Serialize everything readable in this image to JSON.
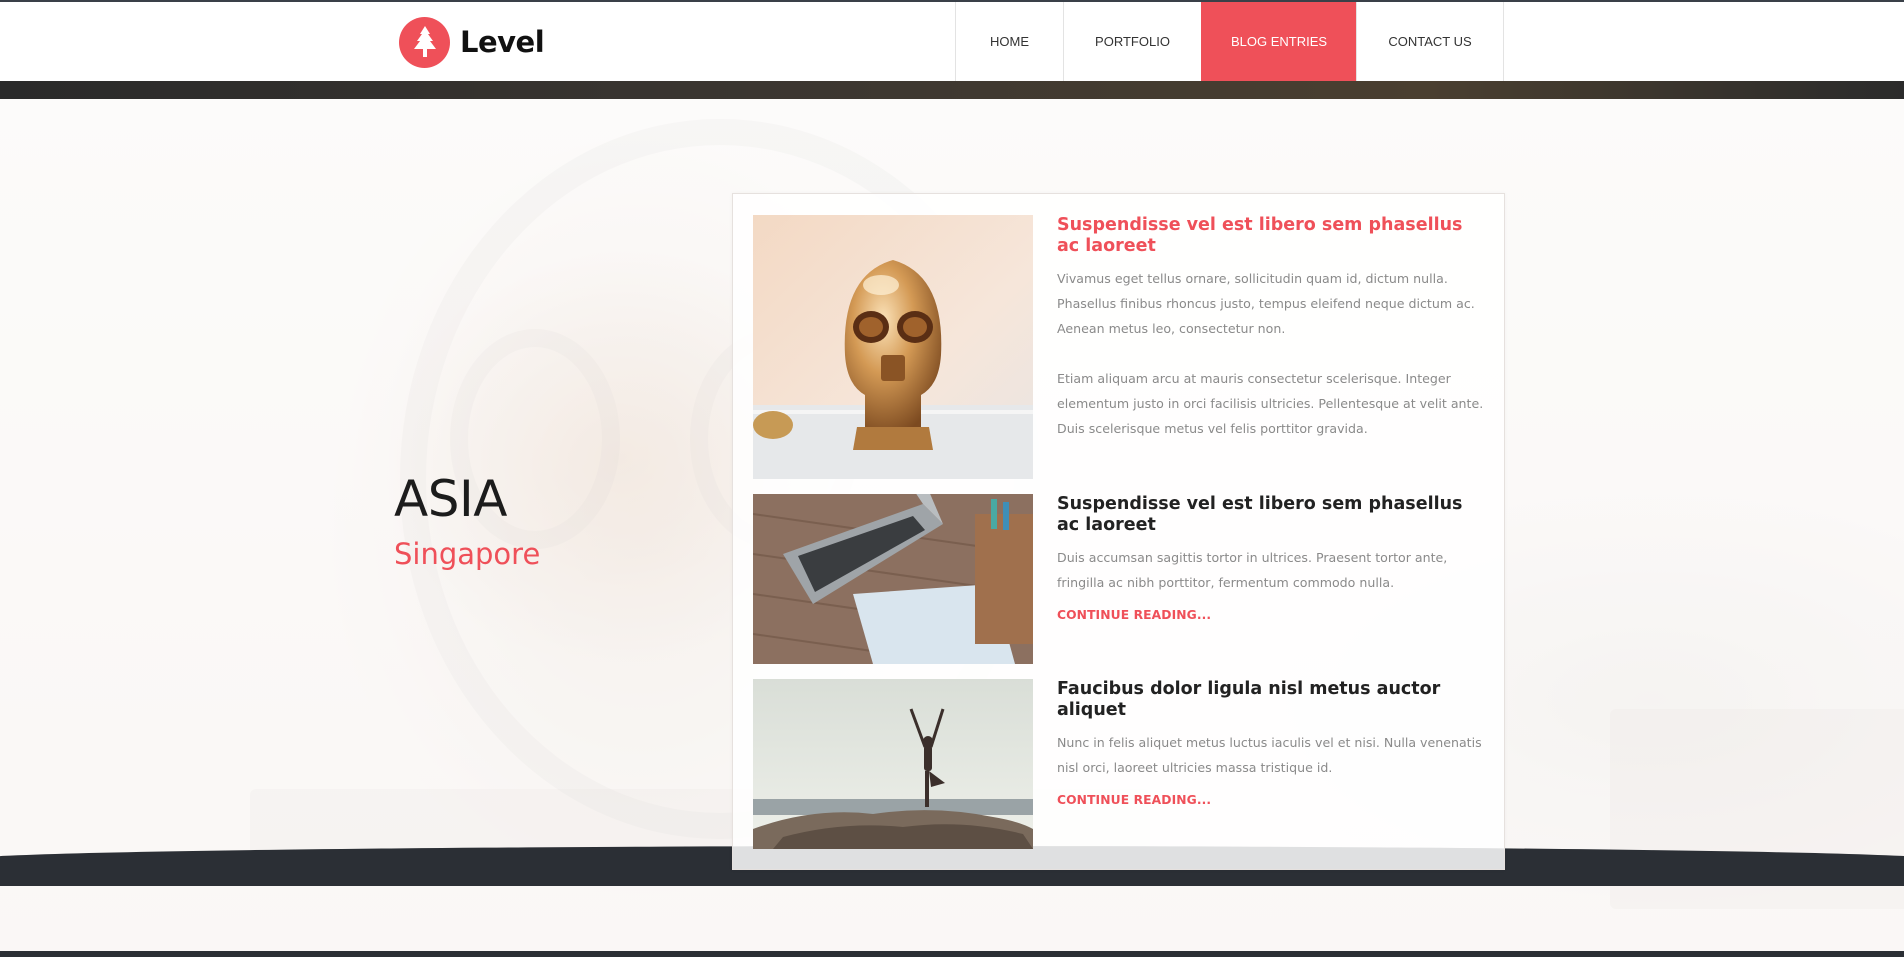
{
  "brand": {
    "name": "Level",
    "logo_icon": "pine-tree-icon",
    "accent_color": "#ef5059"
  },
  "nav": {
    "items": [
      {
        "label": "HOME",
        "active": false
      },
      {
        "label": "PORTFOLIO",
        "active": false
      },
      {
        "label": "BLOG ENTRIES",
        "active": true
      },
      {
        "label": "CONTACT US",
        "active": false
      }
    ]
  },
  "location": {
    "region": "ASIA",
    "city": "Singapore"
  },
  "posts": [
    {
      "title": "Suspendisse vel est libero sem phasellus ac laoreet",
      "highlighted": true,
      "image": "golden-robot-head",
      "paragraphs": [
        "Vivamus eget tellus ornare, sollicitudin quam id, dictum nulla. Phasellus finibus rhoncus justo, tempus eleifend neque dictum ac. Aenean metus leo, consectetur non.",
        "Etiam aliquam arcu at mauris consectetur scelerisque. Integer elementum justo in orci facilisis ultricies. Pellentesque at velit ante. Duis scelerisque metus vel felis porttitor gravida."
      ]
    },
    {
      "title": "Suspendisse vel est libero sem phasellus ac laoreet",
      "highlighted": false,
      "image": "laptop-on-desk",
      "paragraphs": [
        "Duis accumsan sagittis tortor in ultrices. Praesent tortor ante, fringilla ac nibh porttitor, fermentum commodo nulla."
      ],
      "read_more": "CONTINUE READING..."
    },
    {
      "title": "Faucibus dolor ligula nisl metus auctor aliquet",
      "highlighted": false,
      "image": "yoga-on-rocks",
      "paragraphs": [
        "Nunc in felis aliquet metus luctus iaculis vel et nisi. Nulla venenatis nisl orci, laoreet ultricies massa tristique id."
      ],
      "read_more": "CONTINUE READING..."
    }
  ]
}
